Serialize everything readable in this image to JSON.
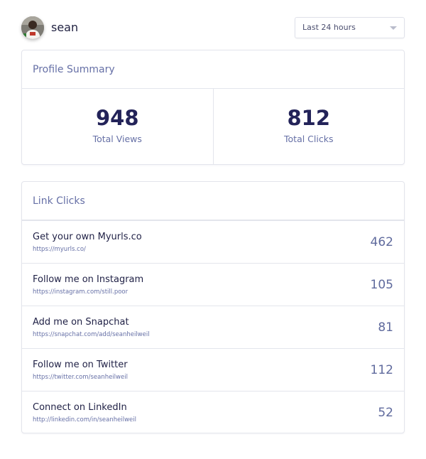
{
  "header": {
    "username": "sean",
    "avatar_icon": "user-photo",
    "time_range": {
      "selected": "Last 24 hours"
    }
  },
  "summary": {
    "title": "Profile Summary",
    "total_views_value": "948",
    "total_views_label": "Total Views",
    "total_clicks_value": "812",
    "total_clicks_label": "Total Clicks"
  },
  "link_clicks": {
    "title": "Link Clicks",
    "items": [
      {
        "title": "Get your own Myurls.co",
        "url": "https://myurls.co/",
        "clicks": "462"
      },
      {
        "title": "Follow me on Instagram",
        "url": "https://instagram.com/still.poor",
        "clicks": "105"
      },
      {
        "title": "Add me on Snapchat",
        "url": "https://snapchat.com/add/seanheilweil",
        "clicks": "81"
      },
      {
        "title": "Follow me on Twitter",
        "url": "https://twitter.com/seanheilweil",
        "clicks": "112"
      },
      {
        "title": "Connect on LinkedIn",
        "url": "http://linkedin.com/in/seanheilweil",
        "clicks": "52"
      }
    ]
  },
  "colors": {
    "primary_text": "#232359",
    "muted_text": "#6670a6",
    "border": "#e3e5ec"
  }
}
